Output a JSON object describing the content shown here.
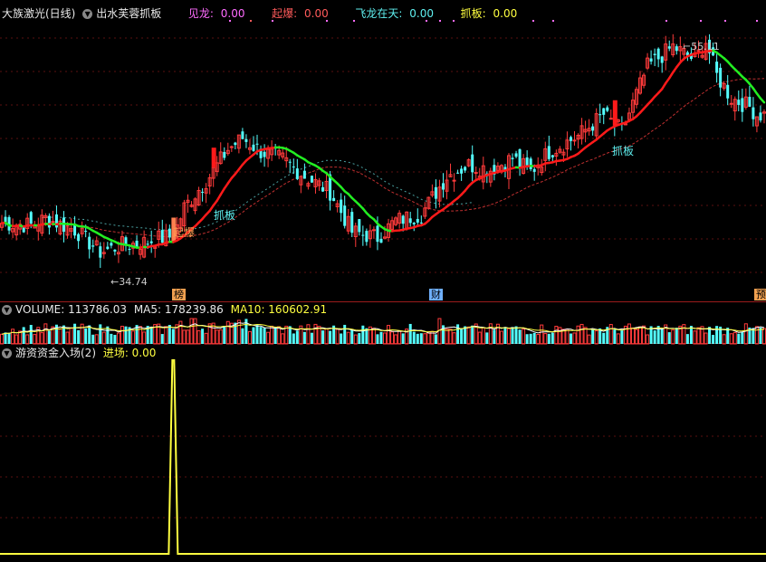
{
  "main_header": {
    "title": "大族激光(日线)",
    "indicator": "出水芙蓉抓板",
    "items": [
      {
        "label": "见龙:",
        "value": "0.00",
        "color": "#ff6bff"
      },
      {
        "label": "起爆:",
        "value": "0.00",
        "color": "#ff5b5b"
      },
      {
        "label": "飞龙在天:",
        "value": "0.00",
        "color": "#5ff0f0"
      },
      {
        "label": "抓板:",
        "value": "0.00",
        "color": "#ffff40"
      }
    ]
  },
  "volume_header": {
    "title": "VOLUME: 113786.03",
    "ma5": "MA5: 178239.86",
    "ma10": "MA10: 160602.91"
  },
  "fund_header": {
    "title": "游资资金入场(2)",
    "item": "进场: 0.00"
  },
  "bottom_flags": [
    "榜",
    "财",
    "预"
  ],
  "colors": {
    "up": "#ff3b3b",
    "down": "#54ffff",
    "ma_red": "#ff1a1a",
    "ma_green": "#22ee22",
    "volume_ma": "#ffff40",
    "separator": "#9b1c1c"
  },
  "chart_data": [
    {
      "type": "candlestick",
      "title": "大族激光(日线)",
      "annotations": [
        {
          "text": "起爆"
        },
        {
          "text": "抓板"
        },
        {
          "text": "抓板"
        },
        {
          "text": "34.74",
          "kind": "low"
        },
        {
          "text": "55.11",
          "kind": "high"
        }
      ],
      "low_marker": 34.74,
      "high_marker": 55.11,
      "ylim": [
        33.0,
        57.0
      ],
      "series": [
        {
          "name": "见龙",
          "value": 0.0
        },
        {
          "name": "起爆",
          "value": 0.0
        },
        {
          "name": "飞龙在天",
          "value": 0.0
        },
        {
          "name": "抓板",
          "value": 0.0
        }
      ],
      "anchors": [
        [
          0,
          38.8
        ],
        [
          8,
          38.6
        ],
        [
          12,
          39.2
        ],
        [
          20,
          38.2
        ],
        [
          27,
          36.2
        ],
        [
          33,
          36.8
        ],
        [
          38,
          37.0
        ],
        [
          43,
          37.4
        ],
        [
          47,
          37.6
        ],
        [
          50,
          40.2
        ],
        [
          57,
          43.0
        ],
        [
          62,
          45.4
        ],
        [
          66,
          46.4
        ],
        [
          71,
          45.2
        ],
        [
          77,
          44.5
        ],
        [
          83,
          43.0
        ],
        [
          90,
          41.6
        ],
        [
          96,
          38.0
        ],
        [
          103,
          37.5
        ],
        [
          108,
          39.0
        ],
        [
          115,
          39.6
        ],
        [
          122,
          43.0
        ],
        [
          128,
          44.0
        ],
        [
          134,
          43.6
        ],
        [
          140,
          44.6
        ],
        [
          145,
          43.4
        ],
        [
          150,
          45.2
        ],
        [
          158,
          46.6
        ],
        [
          165,
          48.5
        ],
        [
          170,
          47.0
        ],
        [
          177,
          52.8
        ],
        [
          184,
          54.6
        ],
        [
          190,
          53.4
        ],
        [
          193,
          55.1
        ],
        [
          196,
          52.0
        ],
        [
          200,
          50.0
        ],
        [
          205,
          49.2
        ],
        [
          207,
          48.5
        ]
      ]
    },
    {
      "type": "bar",
      "title": "VOLUME: 113786.03",
      "series": [
        {
          "name": "VOLUME",
          "value": 113786.03
        },
        {
          "name": "MA5",
          "value": 178239.86
        },
        {
          "name": "MA10",
          "value": 160602.91
        }
      ]
    },
    {
      "type": "line",
      "title": "游资资金入场(2)",
      "series": [
        {
          "name": "进场",
          "value": 0.0
        }
      ],
      "spike_index": 47,
      "spike_value": 1.0
    }
  ]
}
